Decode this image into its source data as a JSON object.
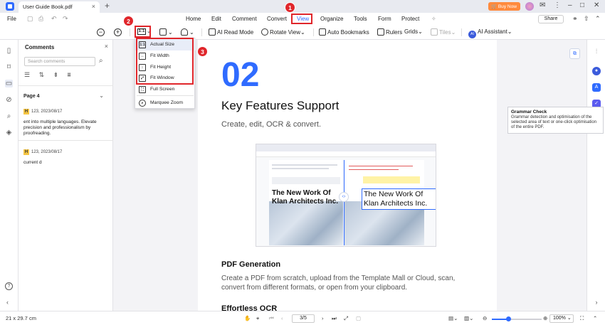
{
  "titlebar": {
    "tab_title": "User Guide Book.pdf",
    "close": "×",
    "new_tab": "+",
    "buy_now": "Buy Now"
  },
  "menubar": {
    "file": "File",
    "items": [
      "Home",
      "Edit",
      "Comment",
      "Convert",
      "View",
      "Organize",
      "Tools",
      "Form",
      "Protect"
    ],
    "active": "View",
    "share": "Share"
  },
  "toolbar": {
    "ratio": "1:1",
    "ai_read_mode": "AI Read Mode",
    "rotate_view": "Rotate View",
    "auto_bookmarks": "Auto Bookmarks",
    "rulers": "Rulers",
    "grids": "Grids",
    "tiles": "Tiles",
    "ai_assistant": "AI Assistant",
    "ai_badge": "AI"
  },
  "dropdown": {
    "items": [
      {
        "label": "Actual Size",
        "icon": "1:1"
      },
      {
        "label": "Fit Width",
        "icon": "↔"
      },
      {
        "label": "Fit Height",
        "icon": "↕"
      },
      {
        "label": "Fit Window",
        "icon": "⤢"
      },
      {
        "label": "Full Screen",
        "icon": "⛶"
      },
      {
        "label": "Marquee Zoom",
        "icon": "⌕"
      }
    ]
  },
  "badges": {
    "b1": "1",
    "b2": "2",
    "b3": "3"
  },
  "comments": {
    "title": "Comments",
    "search_placeholder": "Search comments",
    "page_label": "Page 4",
    "items": [
      {
        "author": "123,",
        "date": "2023/08/17",
        "text": "ent into multiple languages. Elevate precision and professionalism by proofreading."
      },
      {
        "author": "123,",
        "date": "2023/08/17",
        "text": "current d"
      }
    ]
  },
  "document": {
    "big_number": "02",
    "heading": "Key Features Support",
    "subheading": "Create, edit, OCR & convert.",
    "shot_title_left": "The New Work Of Klan Architects Inc.",
    "shot_title_right": "The New Work Of Klan Architects Inc.",
    "section1_title": "PDF Generation",
    "section1_text": "Create a PDF from scratch, upload from the Template Mall or Cloud, scan, convert from different formats, or open from your clipboard.",
    "section2_title": "Effortless OCR"
  },
  "tooltip": {
    "title": "Grammar Check",
    "text": "Grammar detection and optimisation of the selected area of text or one-click optimisation of the entire PDF."
  },
  "status": {
    "page_size": "21 x 29.7 cm",
    "page_input": "3",
    "page_total": "/5",
    "zoom": "100%"
  },
  "colors": {
    "accent": "#2f6bff",
    "highlight_red": "#e0262b",
    "buy_now": "#ff8a3d"
  }
}
